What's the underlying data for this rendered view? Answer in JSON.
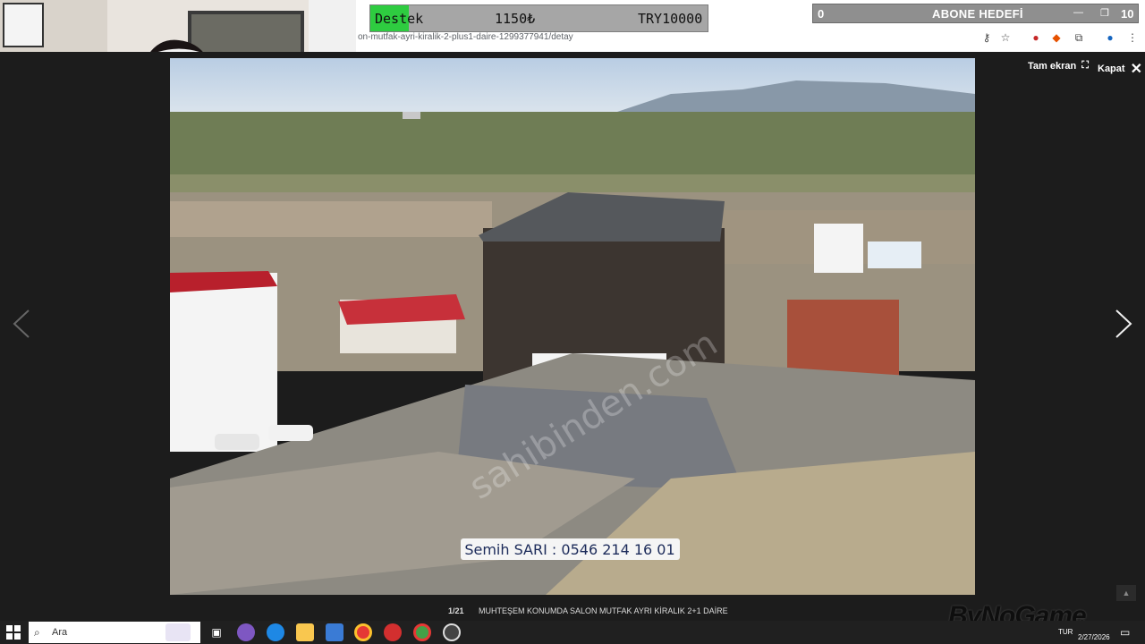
{
  "browser": {
    "url": "on-mutfak-ayri-kiralik-2-plus1-daire-1299377941/detay"
  },
  "donation": {
    "label": "Destek",
    "amount": "1150₺",
    "goal": "TRY10000",
    "progress": 0.115
  },
  "subscriber_goal": {
    "start": "0",
    "label": "ABONE HEDEFİ",
    "goal": "10"
  },
  "viewer": {
    "fullscreen_label": "Tam ekran",
    "close_label": "Kapat",
    "counter": "1/21",
    "caption": "MUHTEŞEM KONUMDA SALON MUTFAK AYRI KİRALIK 2+1 DAİRE",
    "photo_overlay_text": "Semih SARI : 0546 214 16 01",
    "photo_watermark": "sahibinden.com"
  },
  "taskbar": {
    "search_placeholder": "Ara",
    "language": "TUR",
    "date": "2/27/2026"
  },
  "stream_watermark": "ByNoGame",
  "colors": {
    "donation_fill": "#2ecc40",
    "viewer_bg": "#1c1c1c",
    "taskbar_bg": "#202020"
  }
}
